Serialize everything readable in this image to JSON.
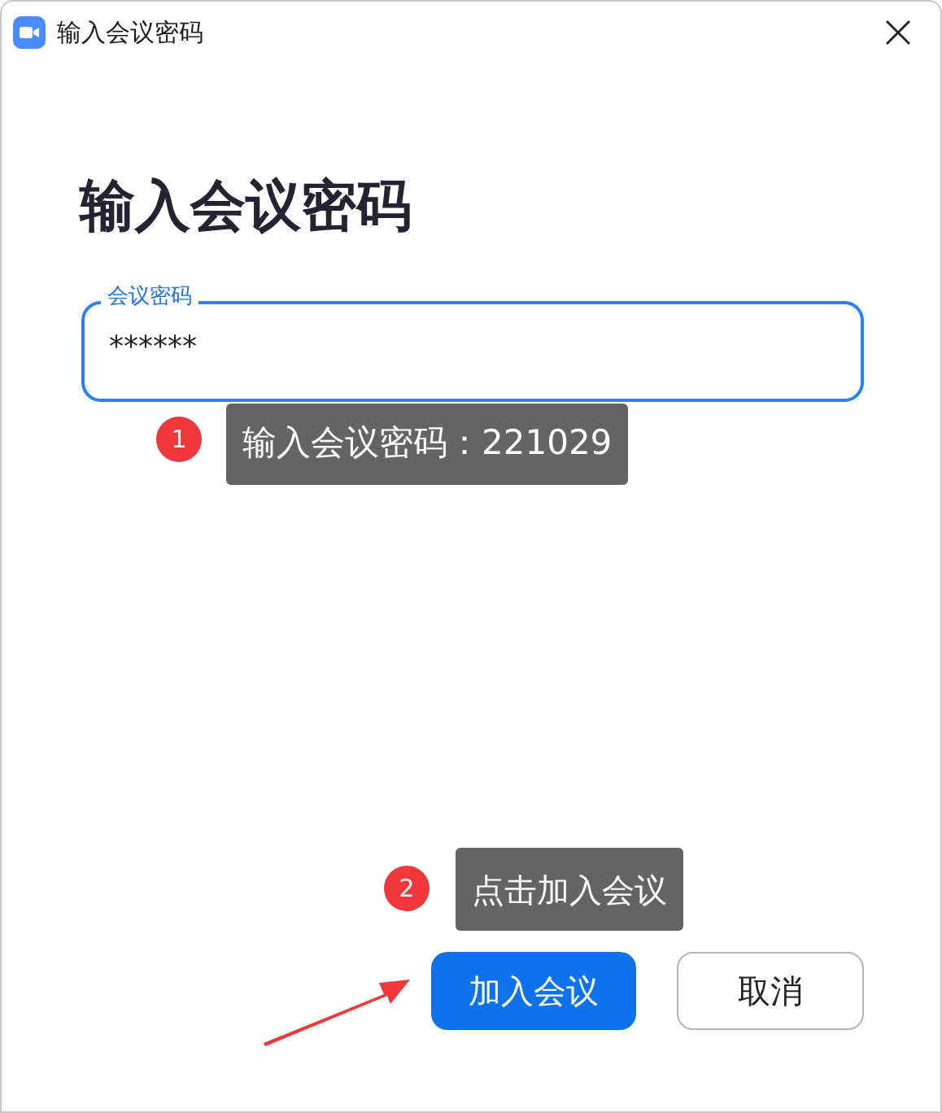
{
  "window": {
    "title": "输入会议密码"
  },
  "heading": "输入会议密码",
  "password_field": {
    "label": "会议密码",
    "value": "******",
    "focused": true
  },
  "buttons": [
    {
      "label": "加入会议",
      "kind": "primary"
    },
    {
      "label": "取消",
      "kind": "secondary"
    }
  ],
  "annotations": [
    {
      "number": "1",
      "text": "输入会议密码：221029"
    },
    {
      "number": "2",
      "text": "点击加入会议"
    }
  ]
}
